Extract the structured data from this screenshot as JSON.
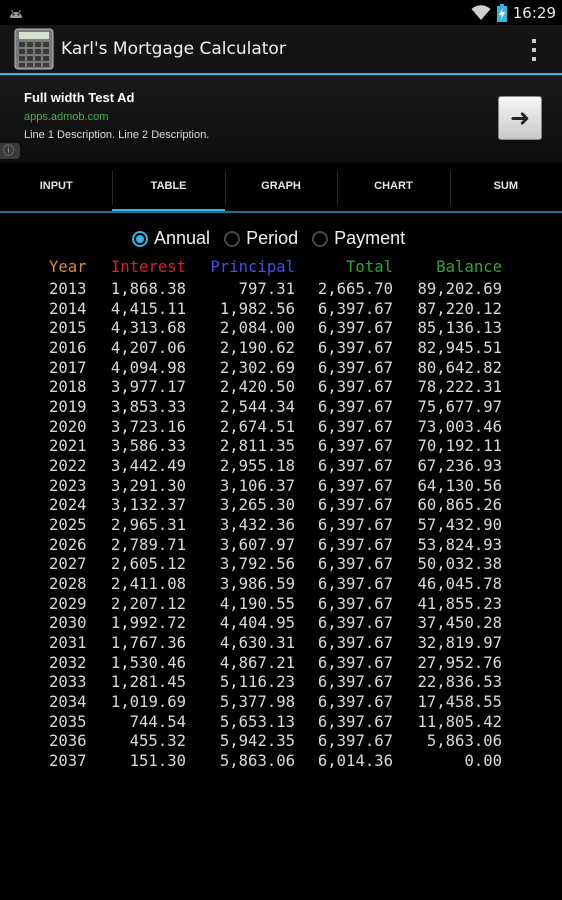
{
  "status": {
    "time": "16:29"
  },
  "app": {
    "title": "Karl's Mortgage Calculator"
  },
  "ad": {
    "title": "Full width Test Ad",
    "url": "apps.admob.com",
    "description": "Line 1 Description. Line 2 Description.",
    "arrow": "➜",
    "info": "ⓘ"
  },
  "tabs": [
    {
      "label": "INPUT",
      "active": false
    },
    {
      "label": "TABLE",
      "active": true
    },
    {
      "label": "GRAPH",
      "active": false
    },
    {
      "label": "CHART",
      "active": false
    },
    {
      "label": "SUM",
      "active": false
    }
  ],
  "period": {
    "options": [
      "Annual",
      "Period",
      "Payment"
    ],
    "selected": "Annual"
  },
  "table": {
    "headers": [
      "Year",
      "Interest",
      "Principal",
      "Total",
      "Balance"
    ],
    "header_colors": [
      "#e08a2c",
      "#e02020",
      "#3a55e8",
      "#2fa82f",
      "#2fa82f"
    ],
    "rows": [
      [
        "2013",
        "1,868.38",
        "797.31",
        "2,665.70",
        "89,202.69"
      ],
      [
        "2014",
        "4,415.11",
        "1,982.56",
        "6,397.67",
        "87,220.12"
      ],
      [
        "2015",
        "4,313.68",
        "2,084.00",
        "6,397.67",
        "85,136.13"
      ],
      [
        "2016",
        "4,207.06",
        "2,190.62",
        "6,397.67",
        "82,945.51"
      ],
      [
        "2017",
        "4,094.98",
        "2,302.69",
        "6,397.67",
        "80,642.82"
      ],
      [
        "2018",
        "3,977.17",
        "2,420.50",
        "6,397.67",
        "78,222.31"
      ],
      [
        "2019",
        "3,853.33",
        "2,544.34",
        "6,397.67",
        "75,677.97"
      ],
      [
        "2020",
        "3,723.16",
        "2,674.51",
        "6,397.67",
        "73,003.46"
      ],
      [
        "2021",
        "3,586.33",
        "2,811.35",
        "6,397.67",
        "70,192.11"
      ],
      [
        "2022",
        "3,442.49",
        "2,955.18",
        "6,397.67",
        "67,236.93"
      ],
      [
        "2023",
        "3,291.30",
        "3,106.37",
        "6,397.67",
        "64,130.56"
      ],
      [
        "2024",
        "3,132.37",
        "3,265.30",
        "6,397.67",
        "60,865.26"
      ],
      [
        "2025",
        "2,965.31",
        "3,432.36",
        "6,397.67",
        "57,432.90"
      ],
      [
        "2026",
        "2,789.71",
        "3,607.97",
        "6,397.67",
        "53,824.93"
      ],
      [
        "2027",
        "2,605.12",
        "3,792.56",
        "6,397.67",
        "50,032.38"
      ],
      [
        "2028",
        "2,411.08",
        "3,986.59",
        "6,397.67",
        "46,045.78"
      ],
      [
        "2029",
        "2,207.12",
        "4,190.55",
        "6,397.67",
        "41,855.23"
      ],
      [
        "2030",
        "1,992.72",
        "4,404.95",
        "6,397.67",
        "37,450.28"
      ],
      [
        "2031",
        "1,767.36",
        "4,630.31",
        "6,397.67",
        "32,819.97"
      ],
      [
        "2032",
        "1,530.46",
        "4,867.21",
        "6,397.67",
        "27,952.76"
      ],
      [
        "2033",
        "1,281.45",
        "5,116.23",
        "6,397.67",
        "22,836.53"
      ],
      [
        "2034",
        "1,019.69",
        "5,377.98",
        "6,397.67",
        "17,458.55"
      ],
      [
        "2035",
        "744.54",
        "5,653.13",
        "6,397.67",
        "11,805.42"
      ],
      [
        "2036",
        "455.32",
        "5,942.35",
        "6,397.67",
        "5,863.06"
      ],
      [
        "2037",
        "151.30",
        "5,863.06",
        "6,014.36",
        "0.00"
      ]
    ]
  }
}
